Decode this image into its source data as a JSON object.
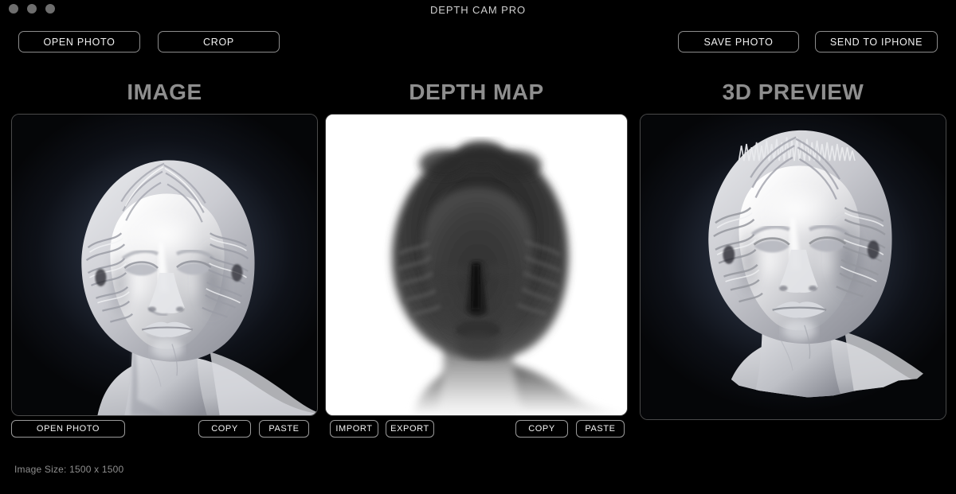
{
  "window": {
    "title": "DEPTH CAM PRO",
    "traffic_lights": [
      "close-button",
      "minimize-button",
      "zoom-button"
    ],
    "background": "#000000"
  },
  "toolbar": {
    "left": [
      {
        "name": "open-photo-button",
        "label": "OPEN PHOTO"
      },
      {
        "name": "crop-button",
        "label": "CROP"
      }
    ],
    "right": [
      {
        "name": "save-photo-button",
        "label": "SAVE PHOTO"
      },
      {
        "name": "send-to-iphone-button",
        "label": "SEND TO IPHONE"
      }
    ]
  },
  "panels": {
    "image": {
      "header": "IMAGE",
      "content": "classical-marble-bust-photo",
      "actions": [
        {
          "name": "image-open-photo-button",
          "label": "OPEN PHOTO"
        },
        {
          "name": "image-copy-button",
          "label": "COPY"
        },
        {
          "name": "image-paste-button",
          "label": "PASTE"
        }
      ]
    },
    "depth_map": {
      "header": "DEPTH MAP",
      "content": "grayscale-depth-silhouette",
      "actions": [
        {
          "name": "depth-import-button",
          "label": "IMPORT"
        },
        {
          "name": "depth-export-button",
          "label": "EXPORT"
        },
        {
          "name": "depth-copy-button",
          "label": "COPY"
        },
        {
          "name": "depth-paste-button",
          "label": "PASTE"
        }
      ]
    },
    "preview_3d": {
      "header": "3D PREVIEW",
      "content": "displaced-mesh-render",
      "actions": []
    }
  },
  "status": {
    "image_size_label": "Image Size: 1500 x 1500"
  },
  "colors": {
    "background": "#000000",
    "header_text": "#8e8e8e",
    "button_border": "#8c8c8c",
    "button_text": "#f2f2f2",
    "title_text": "#cfcfcf",
    "traffic_light": "#6e6e6e",
    "depth_map_background": "#ffffff",
    "photo_vignette": "#3a4050"
  }
}
